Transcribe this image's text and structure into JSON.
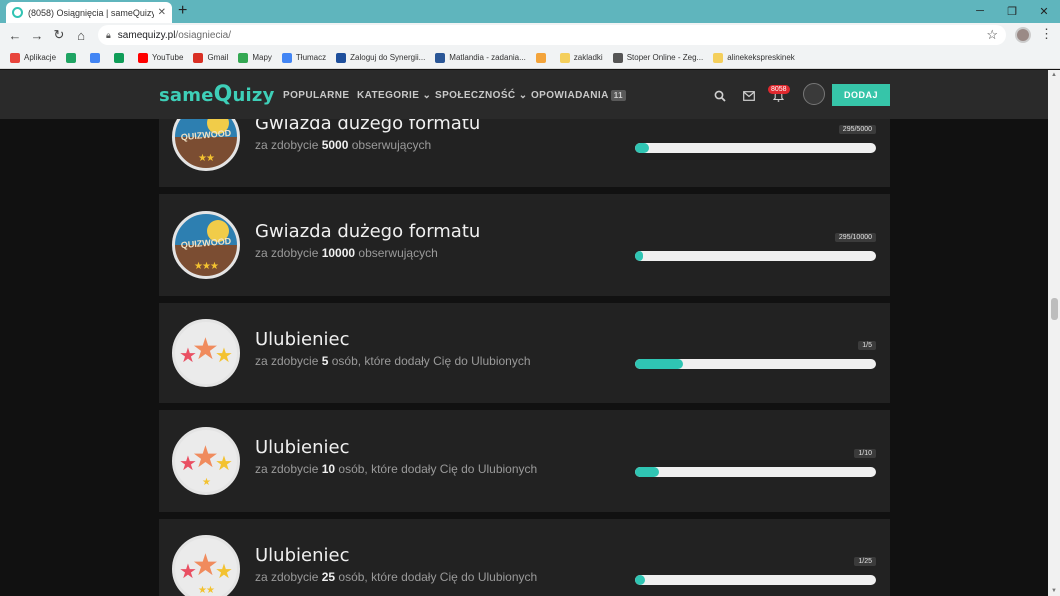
{
  "browser": {
    "tab_title": "(8058) Osiągnięcia | sameQuizy",
    "url_domain": "samequizy.pl",
    "url_path": "/osiagniecia/",
    "bookmarks": [
      {
        "label": "Aplikacje",
        "color": "#e8453c"
      },
      {
        "label": "",
        "color": "#1fa463"
      },
      {
        "label": "",
        "color": "#4285f4"
      },
      {
        "label": "",
        "color": "#0f9d58"
      },
      {
        "label": "YouTube",
        "color": "#ff0000"
      },
      {
        "label": "Gmail",
        "color": "#d93025"
      },
      {
        "label": "Mapy",
        "color": "#34a853"
      },
      {
        "label": "Tłumacz",
        "color": "#4285f4"
      },
      {
        "label": "Zaloguj do Synergii...",
        "color": "#1e4f9c"
      },
      {
        "label": "Matlandia - zadania...",
        "color": "#2b5797"
      },
      {
        "label": "",
        "color": "#f3a43b"
      },
      {
        "label": "zakladki",
        "color": "#f4cf5c"
      },
      {
        "label": "Stoper Online - Zeg...",
        "color": "#555555"
      },
      {
        "label": "alinekekspreskinek",
        "color": "#f4cf5c"
      }
    ]
  },
  "header": {
    "logo_same": "same",
    "logo_q": "Q",
    "logo_rest": "uizy",
    "nav": {
      "popularne": "POPULARNE",
      "kategorie": "KATEGORIE ⌄",
      "spolecznosc": "SPOŁECZNOŚĆ ⌄",
      "opowiadania": "OPOWIADANIA",
      "opowiadania_count": "11"
    },
    "notification_count": "8058",
    "add_label": "DODAJ"
  },
  "achievements": [
    {
      "title": "Gwiazda dużego formatu",
      "desc_prefix": "za zdobycie ",
      "desc_number": "5000",
      "desc_suffix": " obserwujących",
      "badge_type": "quizwood",
      "badge_text": "QUIZWOOD",
      "badge_stars": "★★",
      "progress_label": "295/5000",
      "progress": 0.059
    },
    {
      "title": "Gwiazda dużego formatu",
      "desc_prefix": "za zdobycie ",
      "desc_number": "10000",
      "desc_suffix": " obserwujących",
      "badge_type": "quizwood",
      "badge_text": "QUIZWOOD",
      "badge_stars": "★★★",
      "progress_label": "295/10000",
      "progress": 0.0295
    },
    {
      "title": "Ulubieniec",
      "desc_prefix": "za zdobycie ",
      "desc_number": "5",
      "desc_suffix": " osób, które dodały Cię do Ulubionych",
      "badge_type": "favorites",
      "badge_stars": "",
      "progress_label": "1/5",
      "progress": 0.2
    },
    {
      "title": "Ulubieniec",
      "desc_prefix": "za zdobycie ",
      "desc_number": "10",
      "desc_suffix": " osób, które dodały Cię do Ulubionych",
      "badge_type": "favorites",
      "badge_stars": "★",
      "progress_label": "1/10",
      "progress": 0.1
    },
    {
      "title": "Ulubieniec",
      "desc_prefix": "za zdobycie ",
      "desc_number": "25",
      "desc_suffix": " osób, które dodały Cię do Ulubionych",
      "badge_type": "favorites",
      "badge_stars": "★★",
      "progress_label": "1/25",
      "progress": 0.04
    }
  ],
  "colors": {
    "accent": "#36c5a9",
    "progress_fill": "#2fc5b3",
    "badge_red": "#e94f62",
    "badge_orange": "#f08b5d",
    "badge_gold": "#f3c230"
  }
}
